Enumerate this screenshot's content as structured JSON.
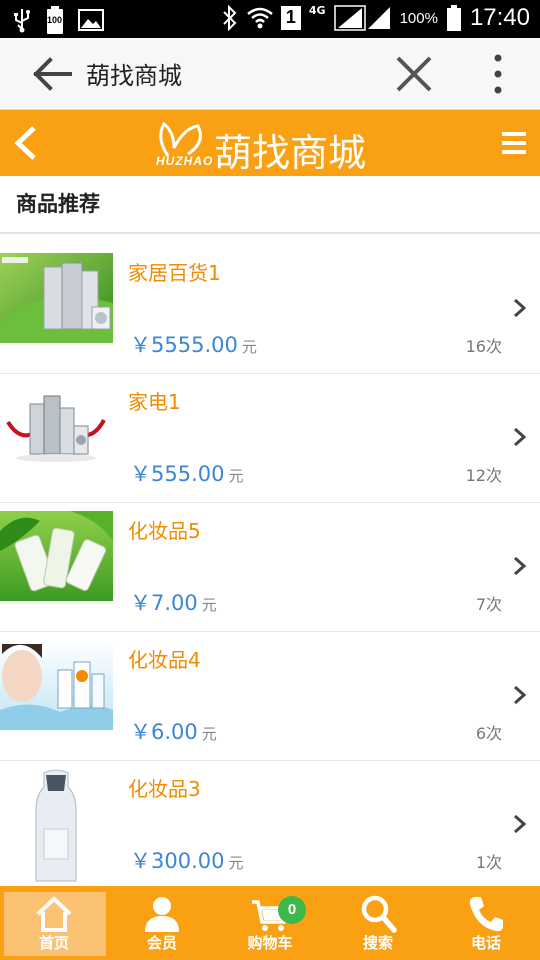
{
  "status_bar": {
    "battery_icon_text": "100",
    "network": "4G",
    "sim_slot": "1",
    "battery_percent": "100%",
    "time": "17:40"
  },
  "browser": {
    "title": "葫找商城"
  },
  "header": {
    "logo_sub": "HUZHAO",
    "logo_text": "葫找商城"
  },
  "section": {
    "title": "商品推荐"
  },
  "products": [
    {
      "name": "家居百货1",
      "price": "￥5555.00",
      "unit": "元",
      "count": "16次",
      "image": "appliances-green-leaf"
    },
    {
      "name": "家电1",
      "price": "￥555.00",
      "unit": "元",
      "count": "12次",
      "image": "home-appliances"
    },
    {
      "name": "化妆品5",
      "price": "￥7.00",
      "unit": "元",
      "count": "7次",
      "image": "green-cosmetics"
    },
    {
      "name": "化妆品4",
      "price": "￥6.00",
      "unit": "元",
      "count": "6次",
      "image": "model-skincare"
    },
    {
      "name": "化妆品3",
      "price": "￥300.00",
      "unit": "元",
      "count": "1次",
      "image": "bottle-cosmetic"
    }
  ],
  "nav": [
    {
      "label": "首页",
      "icon": "home-icon",
      "active": true
    },
    {
      "label": "会员",
      "icon": "member-icon",
      "active": false
    },
    {
      "label": "购物车",
      "icon": "cart-icon",
      "active": false,
      "badge": "0"
    },
    {
      "label": "搜索",
      "icon": "search-icon",
      "active": false
    },
    {
      "label": "电话",
      "icon": "phone-icon",
      "active": false
    }
  ],
  "colors": {
    "accent": "#f9a013",
    "product_name": "#f08c00",
    "price": "#3b86d6",
    "badge": "#3cb94a"
  }
}
